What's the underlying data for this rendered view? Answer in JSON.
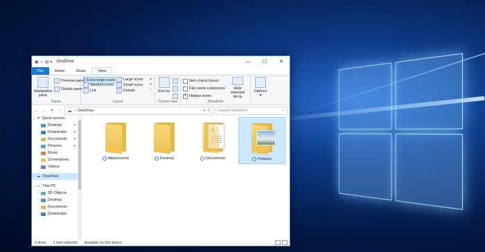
{
  "window": {
    "title": "OneDrive",
    "controls": [
      "—",
      "☐",
      "✕"
    ]
  },
  "ribbon_tabs": [
    "File",
    "Home",
    "Share",
    "View"
  ],
  "ribbon": {
    "panes": {
      "navigation_pane": "Navigation pane",
      "preview_pane": "Preview pane",
      "details_pane": "Details pane",
      "label": "Panes"
    },
    "layout": {
      "items": [
        "Extra large icons",
        "Large icons",
        "Medium icons",
        "Small icons",
        "List",
        "Details"
      ],
      "label": "Layout"
    },
    "current_view": {
      "sort_by": "Sort by",
      "label": "Current view"
    },
    "show_hide": {
      "item_check_boxes": "Item check boxes",
      "file_name_extensions": "File name extensions",
      "hidden_items": "Hidden items",
      "hide_selected": "Hide selected items",
      "label": "Show/hide"
    },
    "options": "Options"
  },
  "address": {
    "path": "OneDrive",
    "search_placeholder": "Search OneDrive"
  },
  "nav": {
    "quick_access": "Quick access",
    "quick_items": [
      {
        "label": "Desktop",
        "color": "#4a90d9"
      },
      {
        "label": "Downloads",
        "color": "#3a7fd0"
      },
      {
        "label": "Documents",
        "color": "#d9b45a"
      },
      {
        "label": "Pictures",
        "color": "#5aa0d9"
      },
      {
        "label": "Music",
        "color": "#e07a3a"
      },
      {
        "label": "Screenshots",
        "color": "#e8c25a"
      },
      {
        "label": "Videos",
        "color": "#6a7fd9"
      }
    ],
    "onedrive": "OneDrive",
    "this_pc": "This PC",
    "pc_items": [
      {
        "label": "3D Objects",
        "color": "#6aa6e0"
      },
      {
        "label": "Desktop",
        "color": "#4a90d9"
      },
      {
        "label": "Documents",
        "color": "#d9b45a"
      },
      {
        "label": "Downloads",
        "color": "#3a7fd0"
      }
    ]
  },
  "items": [
    {
      "label": "Attachments",
      "type": "folder",
      "status": "cloud"
    },
    {
      "label": "Desktop",
      "type": "folder",
      "status": "cloud"
    },
    {
      "label": "Documents",
      "type": "folder-doc",
      "status": "ok"
    },
    {
      "label": "Pictures",
      "type": "folder-pic",
      "status": "ok"
    }
  ],
  "status_bar": {
    "count": "4 items",
    "selected": "1 item selected",
    "availability": "Available on this device"
  }
}
